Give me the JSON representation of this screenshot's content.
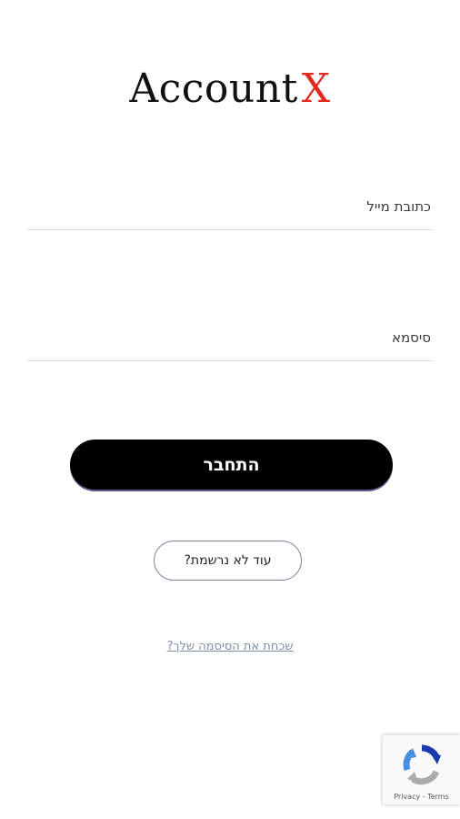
{
  "logo": {
    "brand": "Account",
    "mark": "X",
    "mark_color": "#e0291f"
  },
  "form": {
    "email_placeholder": "כתובת מייל",
    "password_placeholder": "סיסמא",
    "login_label": "התחבר",
    "register_label": "עוד לא נרשמת?",
    "forgot_label": "שכחת את הסיסמה שלך?"
  },
  "recaptcha": {
    "privacy_label": "Privacy",
    "separator": " - ",
    "terms_label": "Terms",
    "icon": "recaptcha-icon"
  }
}
